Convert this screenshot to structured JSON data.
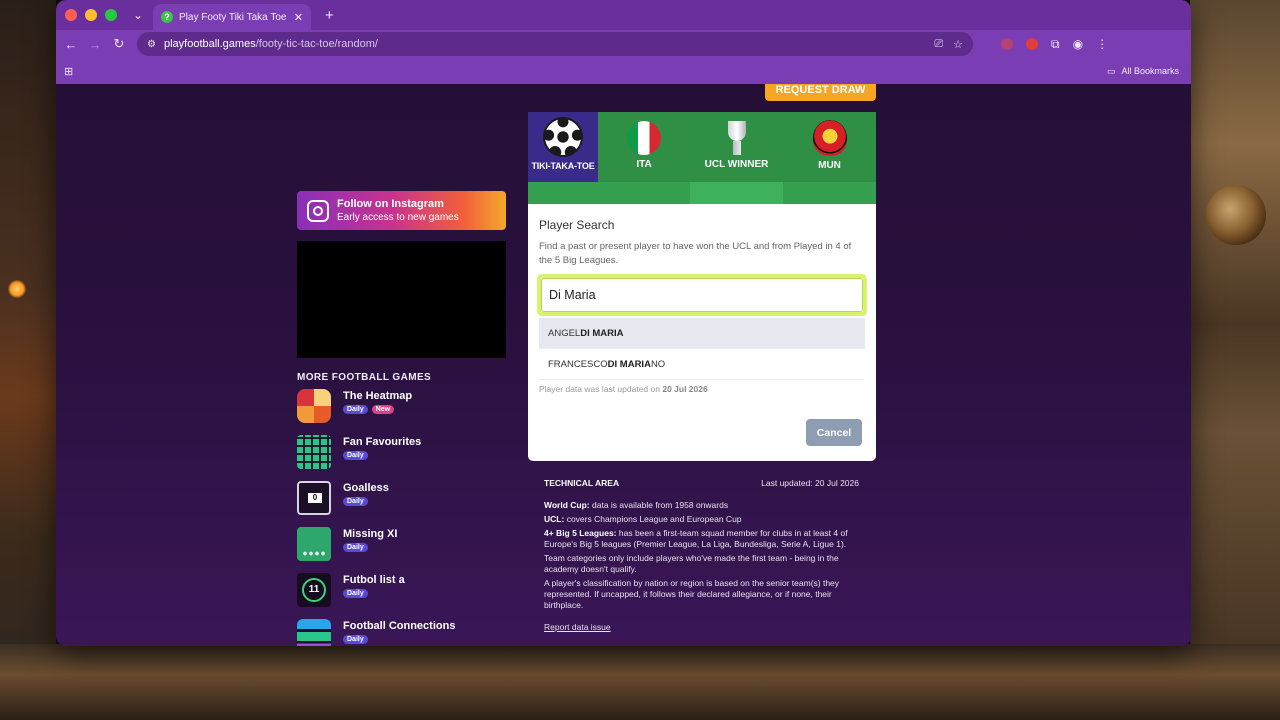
{
  "browser": {
    "tab_title": "Play Footy Tiki Taka Toe onli",
    "url_host": "playfootball.games",
    "url_path": "/footy-tic-tac-toe/random/",
    "bookmarks_label": "All Bookmarks"
  },
  "left": {
    "instagram_title": "Follow on Instagram",
    "instagram_sub": "Early access to new games",
    "more_heading": "MORE FOOTBALL GAMES",
    "games": [
      {
        "name": "The Heatmap",
        "badges": [
          "Daily",
          "New"
        ]
      },
      {
        "name": "Fan Favourites",
        "badges": [
          "Daily"
        ]
      },
      {
        "name": "Goalless",
        "badges": [
          "Daily"
        ],
        "icon_text": "0"
      },
      {
        "name": "Missing XI",
        "badges": [
          "Daily"
        ]
      },
      {
        "name": "Futbol list a",
        "badges": [
          "Daily"
        ],
        "icon_text": "11"
      },
      {
        "name": "Football Connections",
        "badges": [
          "Daily"
        ]
      }
    ]
  },
  "board": {
    "request_draw": "REQUEST DRAW",
    "logo_text": "TIKI-TAKA-TOE",
    "columns": [
      "ITA",
      "UCL WINNER",
      "MUN"
    ]
  },
  "modal": {
    "title": "Player Search",
    "description": "Find a past or present player to have won the UCL and from Played in 4 of the 5 Big Leagues.",
    "search_value": "Di Maria",
    "suggestions": [
      {
        "pre": "ANGEL ",
        "match": "DI MARIA",
        "post": ""
      },
      {
        "pre": "FRANCESCO ",
        "match": "DI MARIA",
        "post": "NO"
      }
    ],
    "updated_prefix": "Player data was last updated on",
    "updated_date": "20 Jul 2026",
    "cancel_label": "Cancel"
  },
  "tech": {
    "title": "TECHNICAL AREA",
    "last_updated": "Last updated: 20 Jul 2026",
    "wc_label": "World Cup:",
    "wc_text": "data is available from 1958 onwards",
    "ucl_label": "UCL:",
    "ucl_text": "covers Champions League and European Cup",
    "big5_label": "4+ Big 5 Leagues:",
    "big5_text": "has been a first-team squad member for clubs in at least 4 of Europe's Big 5 leagues (Premier League, La Liga, Bundesliga, Serie A, Ligue 1).",
    "team_text": "Team categories only include players who've made the first team - being in the academy doesn't qualify.",
    "nation_text": "A player's classification by nation or region is based on the senior team(s) they represented. If uncapped, it follows their declared allegiance, or if none, their birthplace.",
    "report_label": "Report data issue"
  },
  "colors": {
    "browser_purple": "#7b3db3",
    "page_bg": "#250f36",
    "board_green": "#2e8f45",
    "accent_orange": "#f5a623",
    "search_highlight": "#d6f36a"
  }
}
